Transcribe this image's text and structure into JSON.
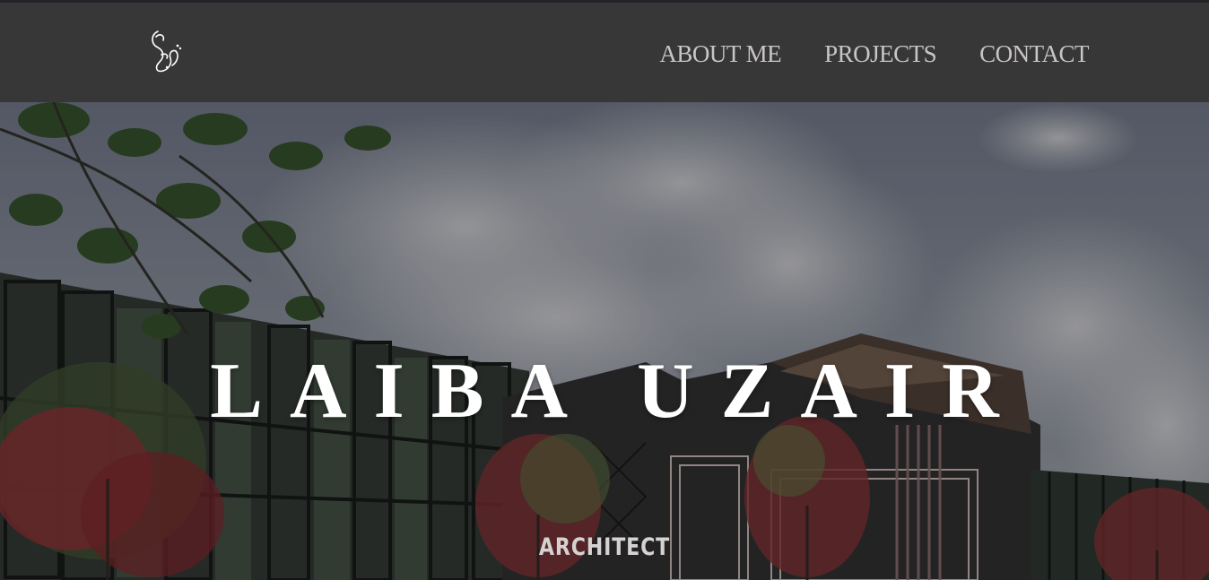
{
  "navbar": {
    "logo": {
      "icon": "arabic-calligraphy-logo-icon",
      "alt_text": "عزیر"
    },
    "links": [
      {
        "label": "ABOUT ME"
      },
      {
        "label": "PROJECTS"
      },
      {
        "label": "CONTACT"
      }
    ]
  },
  "hero": {
    "title": "LAIBA UZAIR",
    "subtitle": "ARCHITECT",
    "background_icon": "building-render-image"
  },
  "colors": {
    "navbar_bg": "#383738",
    "nav_text": "#c8c6c4",
    "title_text": "#ffffff",
    "subtitle_text": "#d6d2d2"
  }
}
